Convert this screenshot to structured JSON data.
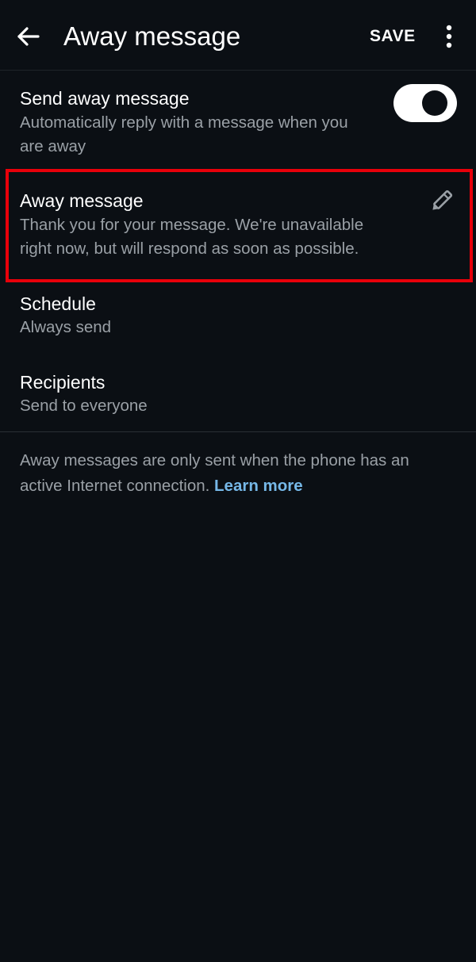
{
  "appbar": {
    "title": "Away message",
    "save_label": "SAVE",
    "back_icon": "arrow-left-icon",
    "more_icon": "more-vert-icon"
  },
  "settings": {
    "send_away": {
      "title": "Send away message",
      "subtitle_line1": "Automatically reply with a message when you",
      "subtitle_line2": "are away",
      "enabled": true
    },
    "away_message": {
      "title": "Away message",
      "text_line1": "Thank you for your message. We're unavailable",
      "text_line2": "right now, but will respond as soon as possible.",
      "edit_icon": "pencil-icon"
    },
    "schedule": {
      "title": "Schedule",
      "value": "Always send"
    },
    "recipients": {
      "title": "Recipients",
      "value": "Send to everyone"
    }
  },
  "footer": {
    "note_line1": "Away messages are only sent when the phone has an",
    "note_line2": "active Internet connection.",
    "learn_more": "Learn more"
  },
  "colors": {
    "background": "#0b0f14",
    "highlight": "#e8000a",
    "link": "#76b8e8",
    "secondary_text": "#9aa0a6"
  }
}
